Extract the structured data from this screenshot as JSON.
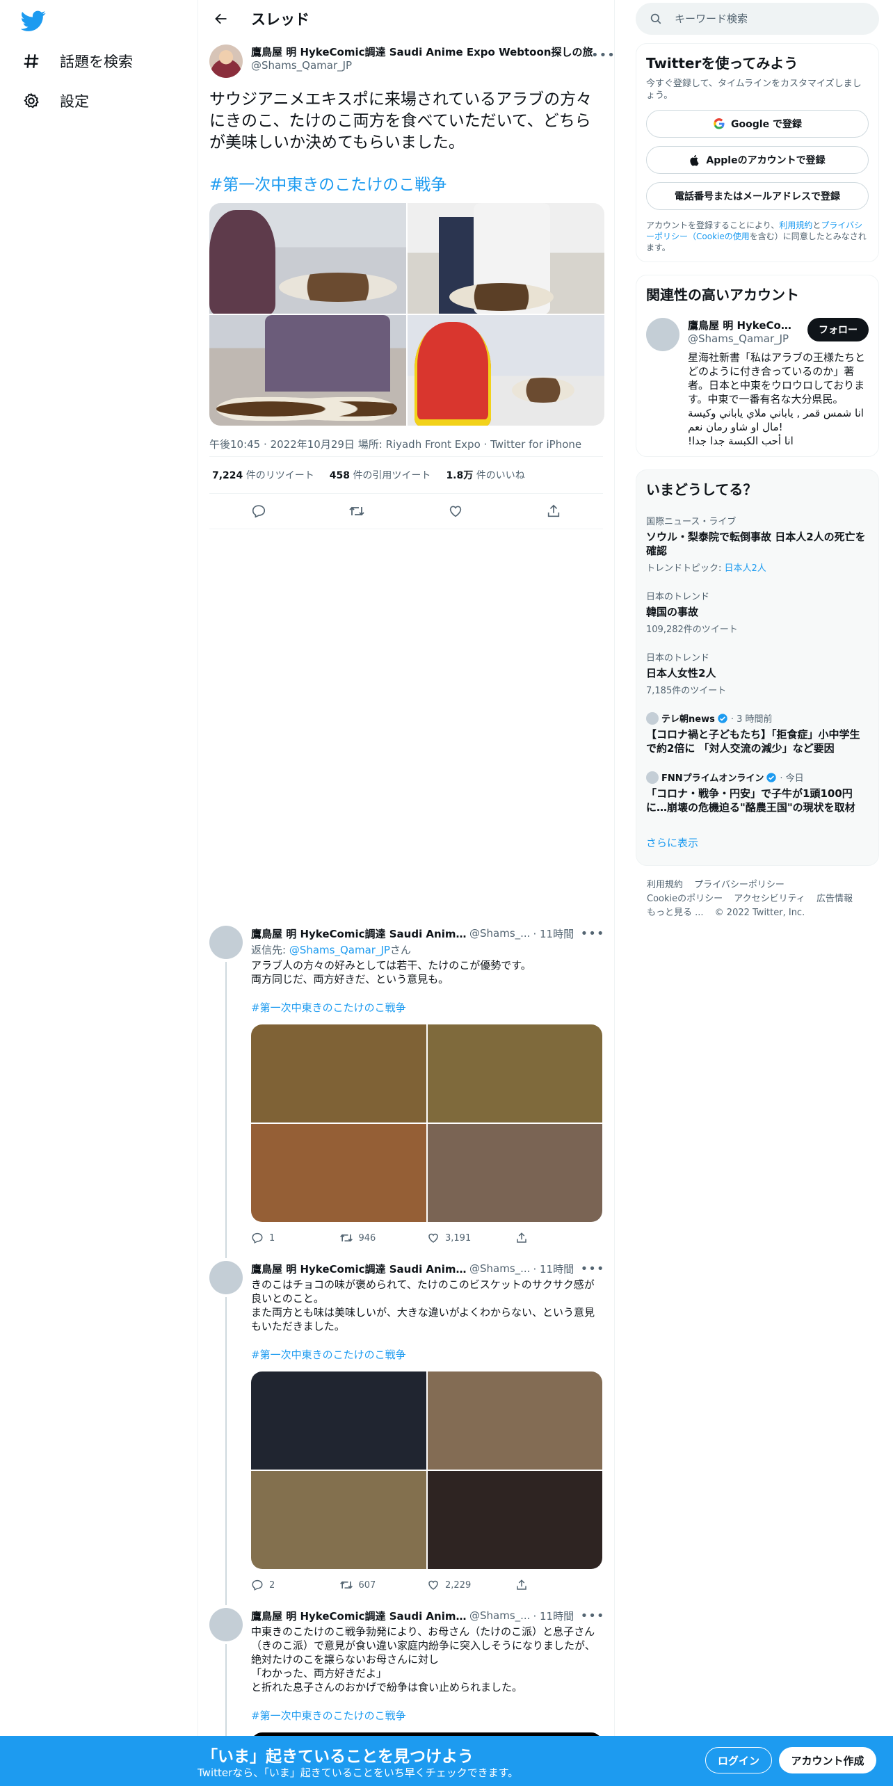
{
  "nav": {
    "explore_label": "話題を検索",
    "settings_label": "設定"
  },
  "thread": {
    "title": "スレッド"
  },
  "main_tweet": {
    "display_name": "鷹鳥屋 明 HykeComic調達 Saudi Anime Expo Webtoon探しの旅",
    "handle": "@Shams_Qamar_JP",
    "text": "サウジアニメエキスポに来場されているアラブの方々にきのこ、たけのこ両方を食べていただいて、どちらが美味しいか決めてもらいました。",
    "hashtag": "#第一次中東きのこたけのこ戦争",
    "time": "午後10:45",
    "date": "2022年10月29日",
    "location": "場所: Riyadh Front Expo",
    "source": "Twitter for iPhone",
    "retweets_count": "7,224",
    "retweets_label": "件のリツイート",
    "quotes_count": "458",
    "quotes_label": "件の引用ツイート",
    "likes_count": "1.8万",
    "likes_label": "件のいいね"
  },
  "replies": [
    {
      "display_name": "鷹鳥屋 明 HykeComic調達 Saudi Anime Exp...",
      "handle": "@Shams_...",
      "time": "· 11時間",
      "replying_prefix": "返信先: ",
      "replying_handle": "@Shams_Qamar_JP",
      "replying_suffix": "さん",
      "text": "アラブ人の方々の好みとしては若干、たけのこが優勢です。\n両方同じだ、両方好きだ、という意見も。",
      "hashtag": "#第一次中東きのこたけのこ戦争",
      "colors": [
        "#7f6236",
        "#7f6a3c",
        "#955f36",
        "#7a6454"
      ],
      "reply_count": "1",
      "retweet_count": "946",
      "like_count": "3,191"
    },
    {
      "display_name": "鷹鳥屋 明 HykeComic調達 Saudi Anime Exp...",
      "handle": "@Shams_...",
      "time": "· 11時間",
      "text": "きのこはチョコの味が褒められて、たけのこのビスケットのサクサク感が良いとのこと。\nまた両方とも味は美味しいが、大きな違いがよくわからない、という意見もいただきました。",
      "hashtag": "#第一次中東きのこたけのこ戦争",
      "colors": [
        "#202530",
        "#836c54",
        "#83704e",
        "#2e2422"
      ],
      "reply_count": "2",
      "retweet_count": "607",
      "like_count": "2,229"
    },
    {
      "display_name": "鷹鳥屋 明 HykeComic調達 Saudi Anime Exp...",
      "handle": "@Shams_...",
      "time": "· 11時間",
      "text": "中東きのこたけのこ戦争勃発により、お母さん（たけのこ派）と息子さん（きのこ派）で意見が食い違い家庭内紛争に突入しそうになりましたが、絶対たけのこを譲らないお母さんに対し\n「わかった、両方好きだよ」\nと折れた息子さんのおかげで紛争は食い止められました。",
      "hashtag": "#第一次中東きのこたけのこ戦争"
    }
  ],
  "search": {
    "placeholder": "キーワード検索"
  },
  "signup_card": {
    "title": "Twitterを使ってみよう",
    "subtitle": "今すぐ登録して、タイムラインをカスタマイズしましょう。",
    "google_label": "Google で登録",
    "apple_label": "Appleのアカウントで登録",
    "phone_label": "電話番号またはメールアドレスで登録",
    "legal_prefix": "アカウントを登録することにより、",
    "legal_terms": "利用規約",
    "legal_and": "と",
    "legal_privacy": "プライバシーポリシー",
    "legal_paren_open": "（",
    "legal_cookie": "Cookieの使用",
    "legal_suffix": "を含む）に同意したとみなされます。"
  },
  "related": {
    "title": "関連性の高いアカウント",
    "name": "鷹鳥屋 明 HykeComi...",
    "handle": "@Shams_Qamar_JP",
    "follow_label": "フォロー",
    "bio": "星海社新書「私はアラブの王様たちとどのように付き合っているのか」著者。日本と中東をウロウロしております。中東で一番有名な大分県民。\nانا شمس قمر , ياباني ملاي ياباني وكيسة مال او شاو رمان نعم!\n!انا أحب الكبسة جدا جدا"
  },
  "trends": {
    "title": "いまどうしてる？",
    "items": [
      {
        "category": "国際ニュース・ライブ",
        "title": "ソウル・梨泰院で転倒事故 日本人2人の死亡を確認",
        "topic_prefix": "トレンドトピック: ",
        "topic": "日本人2人"
      },
      {
        "category": "日本のトレンド",
        "title": "韓国の事故",
        "count": "109,282件のツイート"
      },
      {
        "category": "日本のトレンド",
        "title": "日本人女性2人",
        "count": "7,185件のツイート"
      }
    ],
    "news": [
      {
        "source": "テレ朝news",
        "time": "· 3 時間前",
        "title": "【コロナ禍と子どもたち】「拒食症」小中学生で約2倍に 「対人交流の減少」など要因"
      },
      {
        "source": "FNNプライムオンライン",
        "time": "· 今日",
        "title": "「コロナ・戦争・円安」で子牛が1頭100円に…崩壊の危機迫る\"酪農王国\"の現状を取材"
      }
    ],
    "show_more": "さらに表示"
  },
  "footer": {
    "terms": "利用規約",
    "privacy": "プライバシーポリシー",
    "cookie": "Cookieのポリシー",
    "accessibility": "アクセシビリティ",
    "ads": "広告情報",
    "more": "もっと見る ...",
    "copyright": "© 2022 Twitter, Inc."
  },
  "bottom_bar": {
    "headline": "「いま」起きていることを見つけよう",
    "subtext": "Twitterなら、「いま」起きていることをいち早くチェックできます。",
    "login_label": "ログイン",
    "signup_label": "アカウント作成"
  },
  "colors": {
    "accent": "#1d9bf0",
    "text": "#0f1419",
    "muted": "#536471"
  }
}
